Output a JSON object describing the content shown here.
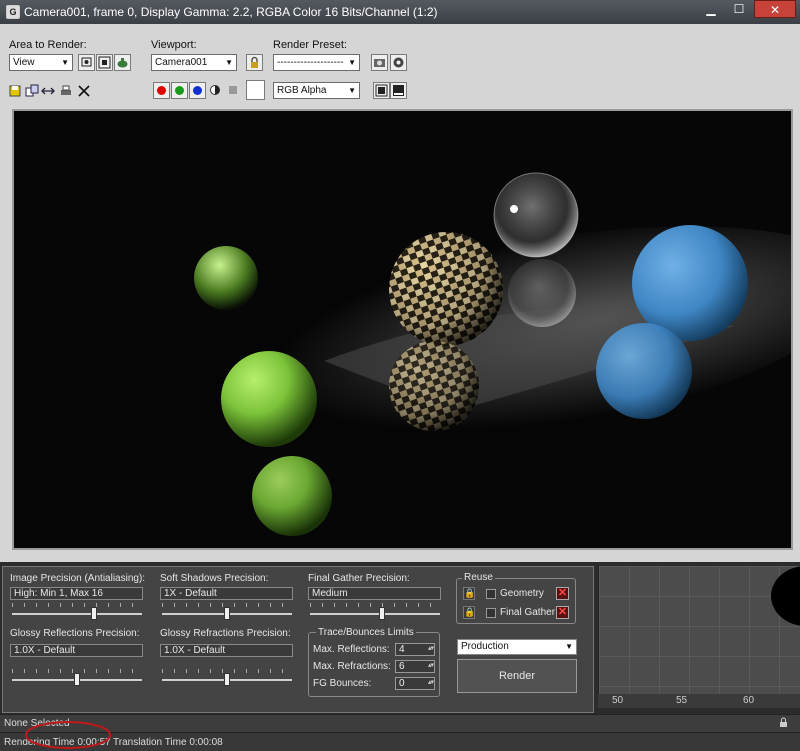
{
  "window": {
    "app_icon_letter": "G",
    "title": "Camera001, frame 0, Display Gamma: 2.2, RGBA Color 16 Bits/Channel (1:2)",
    "minimize_glyph": "▁",
    "maximize_glyph": "☐",
    "close_glyph": "✕"
  },
  "toolbar": {
    "area_to_render_label": "Area to Render:",
    "area_to_render_value": "View",
    "viewport_label": "Viewport:",
    "viewport_value": "Camera001",
    "render_preset_label": "Render Preset:",
    "render_preset_value": "--------------------",
    "channel_value": "RGB Alpha"
  },
  "settings": {
    "image_precision_label": "Image Precision (Antialiasing):",
    "image_precision_value": "High: Min 1, Max 16",
    "image_precision_level": 0.63,
    "soft_shadows_label": "Soft Shadows Precision:",
    "soft_shadows_value": "1X - Default",
    "soft_shadows_level": 0.5,
    "final_gather_label": "Final Gather Precision:",
    "final_gather_value": "Medium",
    "final_gather_level": 0.55,
    "glossy_reflections_label": "Glossy Reflections Precision:",
    "glossy_reflections_value": "1.0X - Default",
    "glossy_reflections_level": 0.5,
    "glossy_refractions_label": "Glossy Refractions Precision:",
    "glossy_refractions_value": "1.0X - Default",
    "glossy_refractions_level": 0.5,
    "trace_group_label": "Trace/Bounces Limits",
    "max_reflections_label": "Max. Reflections:",
    "max_reflections_value": "4",
    "max_refractions_label": "Max. Refractions:",
    "max_refractions_value": "6",
    "fg_bounces_label": "FG Bounces:",
    "fg_bounces_value": "0",
    "reuse_label": "Reuse",
    "geometry_label": "Geometry",
    "final_gather_reuse_label": "Final Gather",
    "production_value": "Production",
    "render_button_label": "Render"
  },
  "ruler": {
    "tick_50": "50",
    "tick_55": "55",
    "tick_60": "60"
  },
  "status": {
    "selection": "None Selected",
    "rendering_time": "Rendering Time  0:00:57",
    "translation_time": "Translation Time  0:00:08"
  },
  "colors": {
    "red_channel": "#e00000",
    "green_channel": "#1a9a1a",
    "blue_channel": "#1030d0",
    "green_sphere": "#7cc43a",
    "blue_sphere": "#3f86c4",
    "annotation_circle": "#c01818"
  }
}
